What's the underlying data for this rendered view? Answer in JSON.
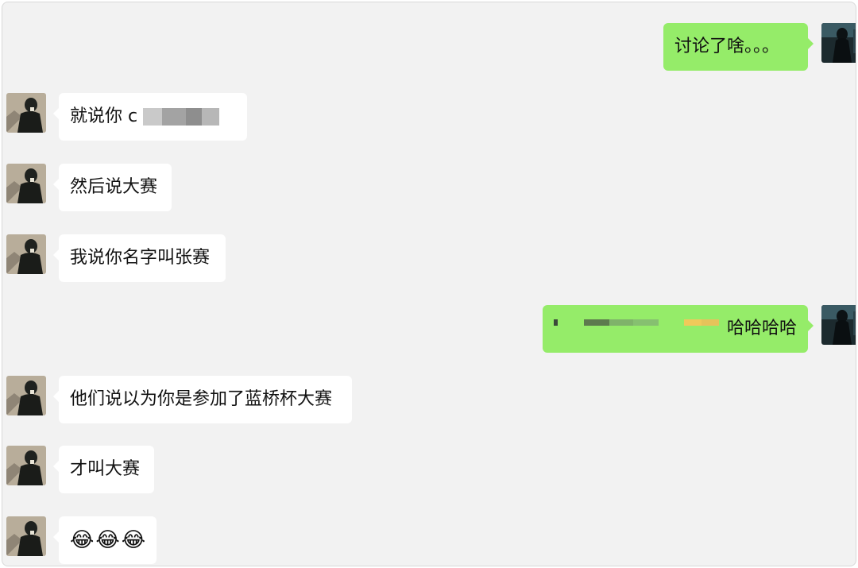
{
  "chat": {
    "messages": [
      {
        "side": "out",
        "text": "讨论了啥。。。"
      },
      {
        "side": "in",
        "text": "就说你 c",
        "redacted": true
      },
      {
        "side": "in",
        "text": "然后说大赛"
      },
      {
        "side": "in",
        "text": "我说你名字叫张赛"
      },
      {
        "side": "out",
        "text": "哈哈哈哈",
        "redacted": true
      },
      {
        "side": "in",
        "text": "他们说以为你是参加了蓝桥杯大赛"
      },
      {
        "side": "in",
        "text": "才叫大赛"
      },
      {
        "side": "in",
        "text": "😂😂😂"
      }
    ]
  },
  "colors": {
    "background": "#f2f2f2",
    "incoming_bubble": "#ffffff",
    "outgoing_bubble": "#95ec69"
  },
  "icons": {
    "incoming_avatar": "avatar-dark-figure-icon",
    "outgoing_avatar": "avatar-dark-silhouette-icon"
  }
}
